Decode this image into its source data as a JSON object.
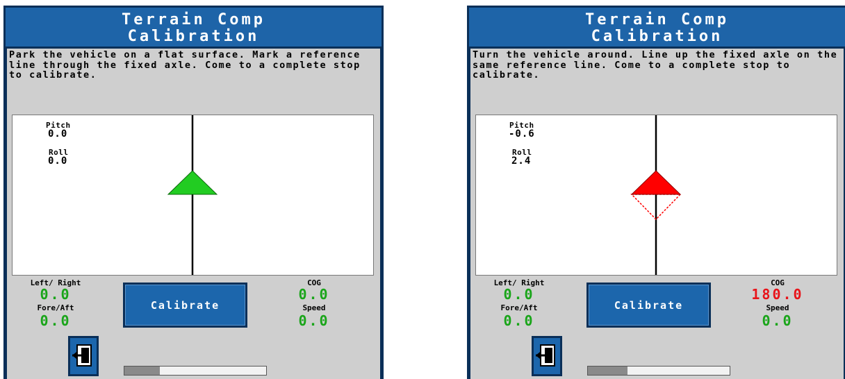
{
  "colors": {
    "green": "#22cc22",
    "red": "#ff0000",
    "header_blue": "#1e64a8",
    "dark_blue": "#0a2f58"
  },
  "screens": [
    {
      "title_line1": "Terrain Comp",
      "title_line2": "Calibration",
      "instructions": "Park the vehicle on a flat surface. Mark a reference line through the fixed axle. Come to a complete stop to calibrate.",
      "pitch_label": "Pitch",
      "pitch_value": "0.0",
      "roll_label": "Roll",
      "roll_value": "0.0",
      "indicator_color": "green",
      "indicator_state": "level",
      "left_right_label": "Left/ Right",
      "left_right_value": "0.0",
      "fore_aft_label": "Fore/Aft",
      "fore_aft_value": "0.0",
      "cog_label": "COG",
      "cog_value": "0.0",
      "cog_color": "green",
      "speed_label": "Speed",
      "speed_value": "0.0",
      "calibrate_label": "Calibrate",
      "exit_icon": "exit-door-icon",
      "progress": 0.25
    },
    {
      "title_line1": "Terrain Comp",
      "title_line2": "Calibration",
      "instructions": "Turn the vehicle around. Line up the fixed axle on the same reference line. Come to a complete stop to calibrate.",
      "pitch_label": "Pitch",
      "pitch_value": "-0.6",
      "roll_label": "Roll",
      "roll_value": "2.4",
      "indicator_color": "red",
      "indicator_state": "reversed",
      "left_right_label": "Left/ Right",
      "left_right_value": "0.0",
      "fore_aft_label": "Fore/Aft",
      "fore_aft_value": "0.0",
      "cog_label": "COG",
      "cog_value": "180.0",
      "cog_color": "red",
      "speed_label": "Speed",
      "speed_value": "0.0",
      "calibrate_label": "Calibrate",
      "exit_icon": "exit-door-icon",
      "progress": 0.28
    }
  ]
}
